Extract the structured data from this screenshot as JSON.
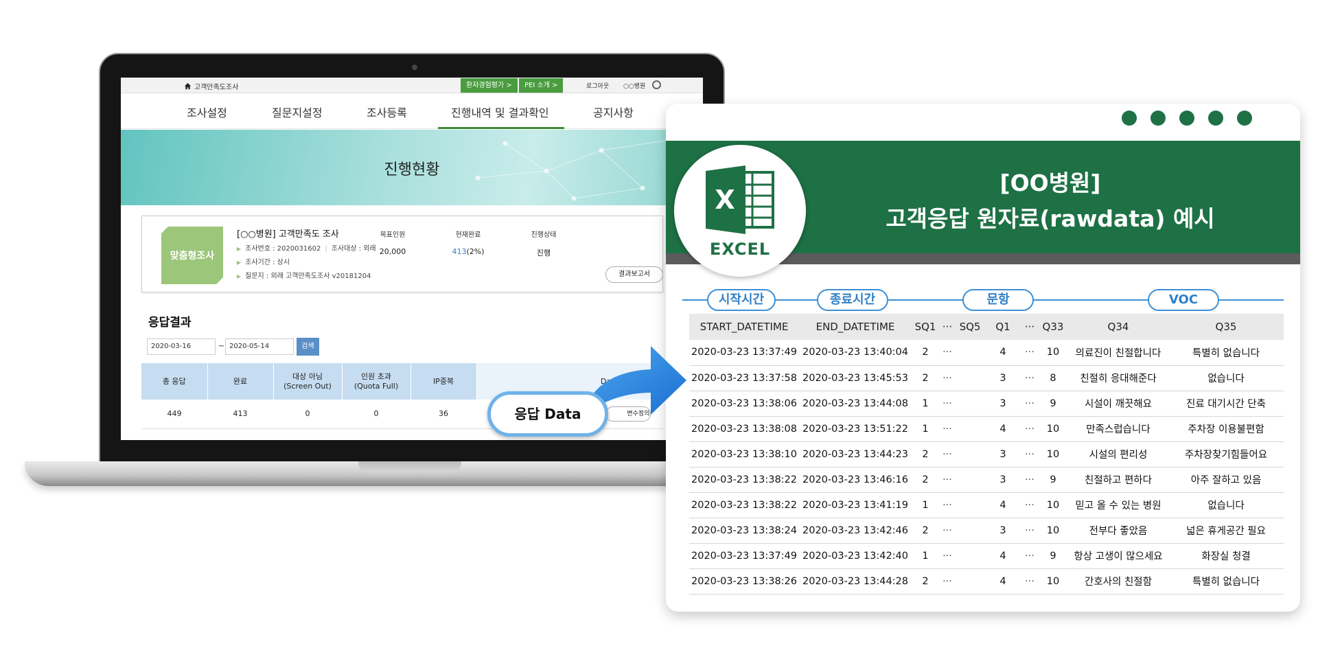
{
  "topbar": {
    "home_label": "고객만족도조사",
    "btn_patient": "환자경험평가 >",
    "btn_pei": "PEI 소개 >",
    "logout": "로그아웃",
    "hospital": "○○병원"
  },
  "nav": [
    "조사설정",
    "질문지설정",
    "조사등록",
    "진행내역 및 결과확인",
    "공지사항"
  ],
  "banner_title": "진행현황",
  "survey": {
    "badge": "맞춤형조사",
    "title": "[○○병원] 고객만족도 조사",
    "number_label": "조사번호 : 2020031602",
    "target_label": "조사대상 : 외래",
    "period_label": "조사기간 : 상시",
    "questionnaire_label": "질문지 : 외래 고객만족도조사 v20181204",
    "target_head": "목표인원",
    "target_value": "20,000",
    "done_head": "현재완료",
    "done_value": "413",
    "done_pct": "(2%)",
    "status_head": "진행상태",
    "status_value": "진행",
    "report_btn": "결과보고서"
  },
  "results": {
    "title": "응답결과",
    "date_from": "2020-03-16",
    "date_sep": "~",
    "date_to": "2020-05-14",
    "search_btn": "검색",
    "headers": [
      "총 응답",
      "완료",
      "대상 아님\n(Screen Out)",
      "인원 초과\n(Quota Full)",
      "IP중복",
      "Data 다운로"
    ],
    "values": [
      "449",
      "413",
      "0",
      "0",
      "36"
    ],
    "var_btn": "변수정의"
  },
  "response_pill": "응답 Data",
  "panel": {
    "title_line1": "[OO병원]",
    "title_line2": "고객응답 원자료(rawdata) 예시",
    "excel_label": "EXCEL",
    "categories": [
      "시작시간",
      "종료시간",
      "문항",
      "VOC"
    ],
    "columns": [
      "START_DATETIME",
      "END_DATETIME",
      "SQ1",
      "···",
      "SQ5",
      "Q1",
      "···",
      "Q33",
      "Q34",
      "Q35"
    ],
    "rows": [
      [
        "2020-03-23 13:37:49",
        "2020-03-23 13:40:04",
        "2",
        "···",
        "",
        "4",
        "···",
        "10",
        "의료진이 친절합니다",
        "특별히 없습니다"
      ],
      [
        "2020-03-23 13:37:58",
        "2020-03-23 13:45:53",
        "2",
        "···",
        "",
        "3",
        "···",
        "8",
        "친절히 응대해준다",
        "없습니다"
      ],
      [
        "2020-03-23 13:38:06",
        "2020-03-23 13:44:08",
        "1",
        "···",
        "",
        "3",
        "···",
        "9",
        "시설이 깨끗해요",
        "진료 대기시간 단축"
      ],
      [
        "2020-03-23 13:38:08",
        "2020-03-23 13:51:22",
        "1",
        "···",
        "",
        "4",
        "···",
        "10",
        "만족스럽습니다",
        "주차장 이용불편함"
      ],
      [
        "2020-03-23 13:38:10",
        "2020-03-23 13:44:23",
        "2",
        "···",
        "",
        "3",
        "···",
        "10",
        "시설의 편리성",
        "주차장찾기힘들어요"
      ],
      [
        "2020-03-23 13:38:22",
        "2020-03-23 13:46:16",
        "2",
        "···",
        "",
        "3",
        "···",
        "9",
        "친절하고 편하다",
        "아주 잘하고 있음"
      ],
      [
        "2020-03-23 13:38:22",
        "2020-03-23 13:41:19",
        "1",
        "···",
        "",
        "4",
        "···",
        "10",
        "믿고 올 수 있는 병원",
        "없습니다"
      ],
      [
        "2020-03-23 13:38:24",
        "2020-03-23 13:42:46",
        "2",
        "···",
        "",
        "3",
        "···",
        "10",
        "전부다 좋았음",
        "넓은 휴게공간 필요"
      ],
      [
        "2020-03-23 13:37:49",
        "2020-03-23 13:42:40",
        "1",
        "···",
        "",
        "4",
        "···",
        "9",
        "항상 고생이 많으세요",
        "화장실 청결"
      ],
      [
        "2020-03-23 13:38:26",
        "2020-03-23 13:44:28",
        "2",
        "···",
        "",
        "4",
        "···",
        "10",
        "간호사의 친절함",
        "특별히 없습니다"
      ]
    ]
  },
  "colors": {
    "excel_green": "#1e7145",
    "accent_blue": "#3d8fd6",
    "nav_green": "#4a9c3f",
    "badge_green": "#9cc67a",
    "table_head_blue": "#c6ddf1"
  }
}
